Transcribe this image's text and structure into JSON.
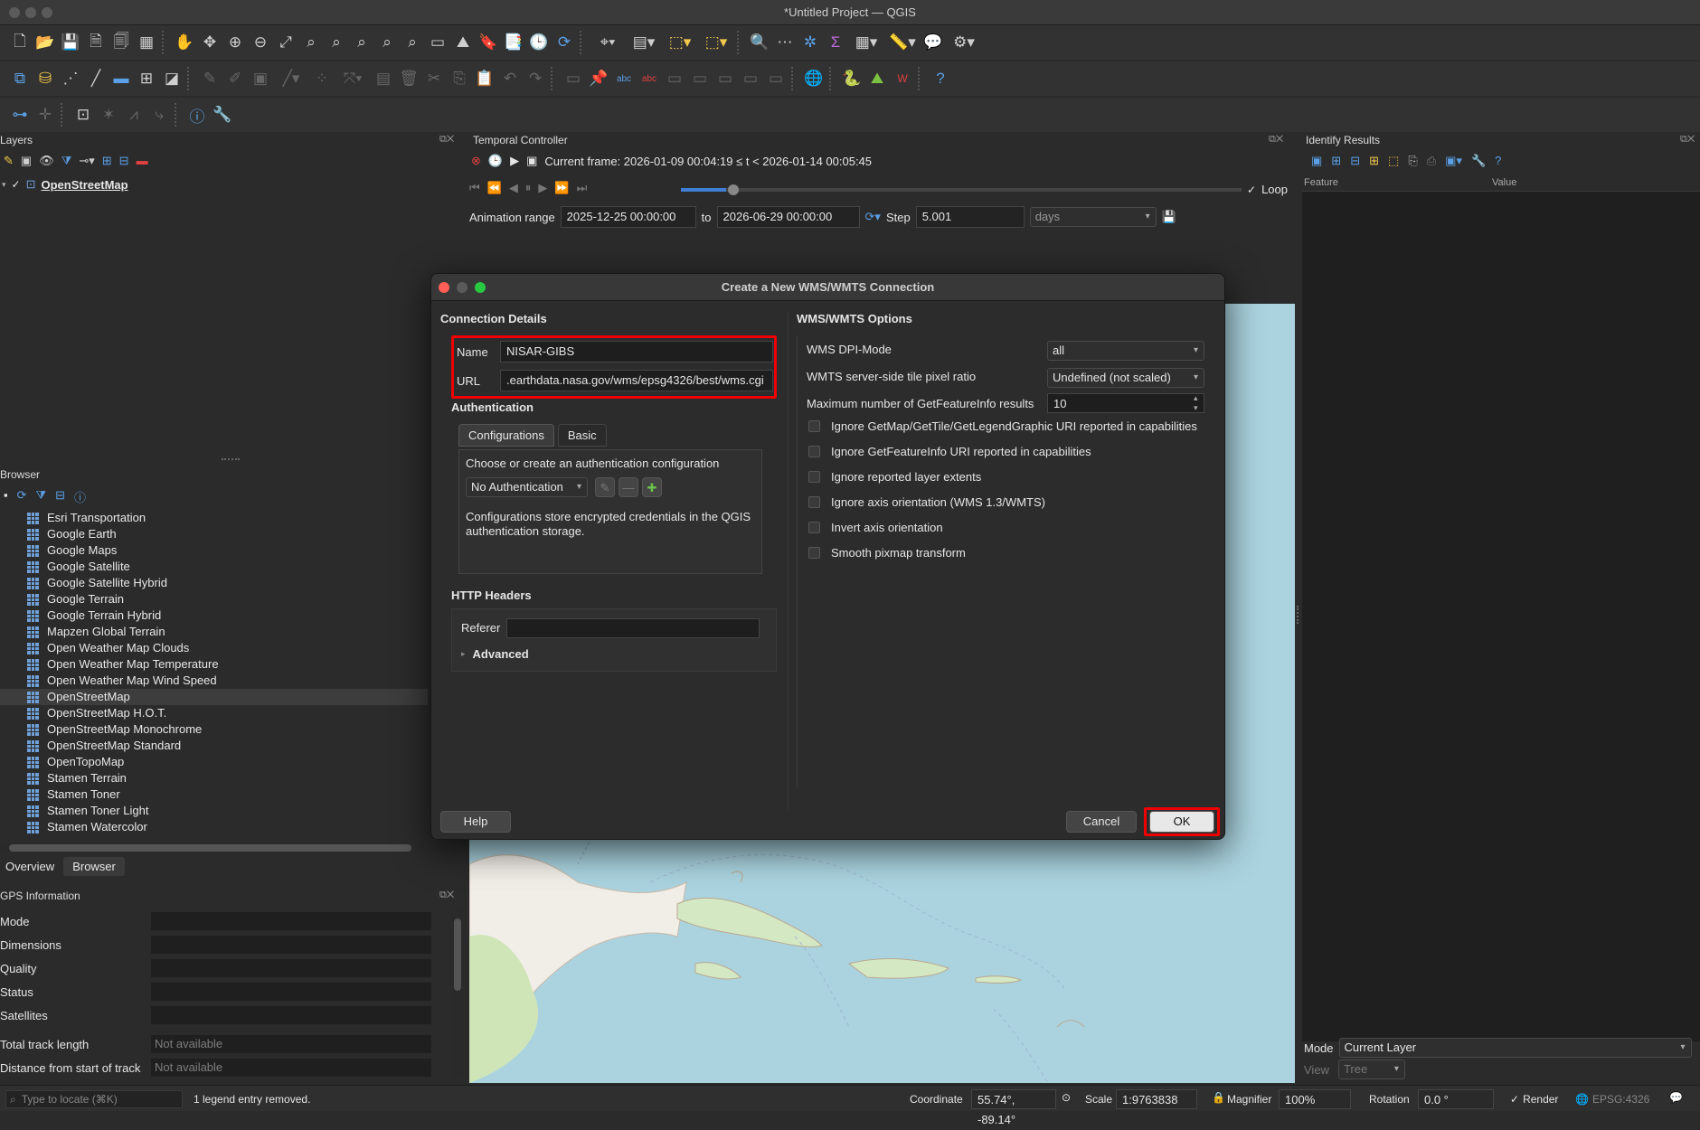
{
  "window": {
    "title": "*Untitled Project — QGIS"
  },
  "layers_panel": {
    "title": "Layers",
    "layer_name": "OpenStreetMap"
  },
  "temporal": {
    "title": "Temporal Controller",
    "current_frame": "Current frame: 2026-01-09 00:04:19 ≤ t < 2026-01-14 00:05:45",
    "loop_label": "Loop",
    "animation_range_label": "Animation range",
    "start": "2025-12-25 00:00:00",
    "to_label": "to",
    "end": "2026-06-29 00:00:00",
    "step_label": "Step",
    "step_value": "5.001",
    "step_unit": "days"
  },
  "identify": {
    "title": "Identify Results",
    "col_feature": "Feature",
    "col_value": "Value",
    "mode_label": "Mode",
    "mode_value": "Current Layer",
    "view_label": "View",
    "view_value": "Tree"
  },
  "browser": {
    "title": "Browser",
    "items": [
      "Esri Transportation",
      "Google Earth",
      "Google Maps",
      "Google Satellite",
      "Google Satellite Hybrid",
      "Google Terrain",
      "Google Terrain Hybrid",
      "Mapzen Global Terrain",
      "Open Weather Map Clouds",
      "Open Weather Map Temperature",
      "Open Weather Map Wind Speed",
      "OpenStreetMap",
      "OpenStreetMap H.O.T.",
      "OpenStreetMap Monochrome",
      "OpenStreetMap Standard",
      "OpenTopoMap",
      "Stamen Terrain",
      "Stamen Toner",
      "Stamen Toner Light",
      "Stamen Watercolor"
    ],
    "selected": "OpenStreetMap",
    "tab_overview": "Overview",
    "tab_browser": "Browser"
  },
  "gps": {
    "title": "GPS Information",
    "rows": [
      {
        "label": "Mode",
        "value": ""
      },
      {
        "label": "Dimensions",
        "value": ""
      },
      {
        "label": "Quality",
        "value": ""
      },
      {
        "label": "Status",
        "value": ""
      },
      {
        "label": "Satellites",
        "value": ""
      }
    ],
    "total_track_label": "Total track length",
    "total_track_value": "Not available",
    "distance_label": "Distance from start of track",
    "distance_value": "Not available"
  },
  "dialog": {
    "title": "Create a New WMS/WMTS Connection",
    "connection_details": "Connection Details",
    "name_label": "Name",
    "name_value": "NISAR-GIBS",
    "url_label": "URL",
    "url_value": ".earthdata.nasa.gov/wms/epsg4326/best/wms.cgi",
    "authentication": "Authentication",
    "tab_configurations": "Configurations",
    "tab_basic": "Basic",
    "auth_prompt": "Choose or create an authentication configuration",
    "auth_value": "No Authentication",
    "auth_note": "Configurations store encrypted credentials in the QGIS authentication storage.",
    "http_headers": "HTTP Headers",
    "referer_label": "Referer",
    "referer_value": "",
    "advanced_label": "Advanced",
    "wms_options": "WMS/WMTS Options",
    "dpi_label": "WMS DPI-Mode",
    "dpi_value": "all",
    "tile_ratio_label": "WMTS server-side tile pixel ratio",
    "tile_ratio_value": "Undefined (not scaled)",
    "max_gfi_label": "Maximum number of GetFeatureInfo results",
    "max_gfi_value": "10",
    "checkboxes": [
      "Ignore GetMap/GetTile/GetLegendGraphic URI reported in capabilities",
      "Ignore GetFeatureInfo URI reported in capabilities",
      "Ignore reported layer extents",
      "Ignore axis orientation (WMS 1.3/WMTS)",
      "Invert axis orientation",
      "Smooth pixmap transform"
    ],
    "help": "Help",
    "cancel": "Cancel",
    "ok": "OK"
  },
  "statusbar": {
    "locate_placeholder": "Type to locate (⌘K)",
    "message": "1 legend entry removed.",
    "coordinate_label": "Coordinate",
    "coordinate_value": "55.74°, -89.14°",
    "scale_label": "Scale",
    "scale_value": "1:9763838",
    "magnifier_label": "Magnifier",
    "magnifier_value": "100%",
    "rotation_label": "Rotation",
    "rotation_value": "0.0 °",
    "render_label": "Render",
    "crs": "EPSG:4326"
  },
  "colors": {
    "highlight_red": "#e00000",
    "accent_blue": "#3f7fd4",
    "map_water": "#aad3df"
  }
}
